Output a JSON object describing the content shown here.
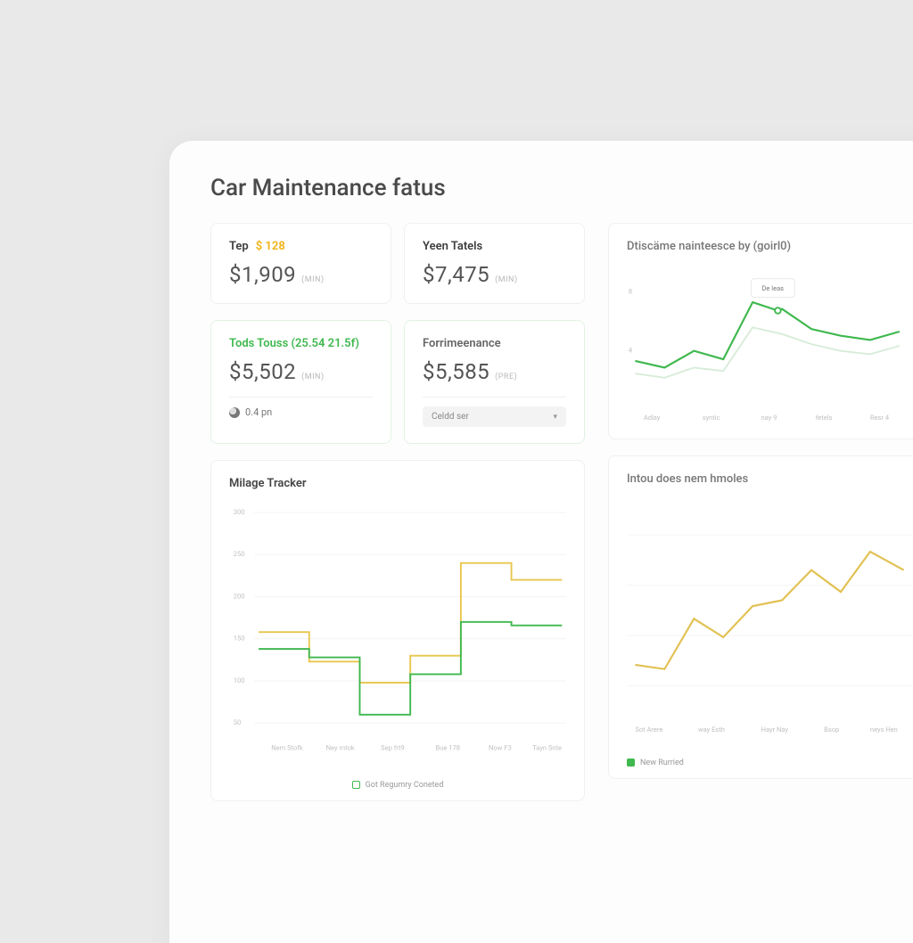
{
  "page": {
    "title": "Car Maintenance fatus"
  },
  "stats": {
    "top_left": {
      "label": "Tep",
      "tag": "$ 128",
      "value": "$1,909",
      "unit": "(min)"
    },
    "top_right": {
      "label": "Yeen Tatels",
      "value": "$7,475",
      "unit": "(min)"
    },
    "mid_left": {
      "label": "Tods Touss (25.54 21.5f)",
      "value": "$5,502",
      "unit": "(min)",
      "foot": "0.4 pn"
    },
    "mid_right": {
      "label": "Forrimeenance",
      "value": "$5,585",
      "unit": "(PRE)",
      "select": "Celdd ser"
    }
  },
  "charts": {
    "top_right": {
      "title": "Dtiscäme nainteesce by (goirl0)",
      "tooltip": "De leas"
    },
    "mileage": {
      "title": "Milage Tracker",
      "legend": "Got Regumry Coneted"
    },
    "bottom_right": {
      "title": "Intou does nem hmoles",
      "legend": "New Rurried"
    }
  },
  "chart_data": [
    {
      "id": "top_right",
      "type": "line",
      "title": "Dtiscäme nainteesce by (goirl0)",
      "x": [
        "Adlay",
        "syntic",
        "nay 9",
        "fetels",
        "Resr 4"
      ],
      "series": [
        {
          "name": "green",
          "color": "#3fb84e",
          "values": [
            40,
            35,
            48,
            38,
            78,
            72,
            62,
            58,
            55,
            60
          ]
        },
        {
          "name": "pale",
          "color": "#d7ecd9",
          "values": [
            30,
            28,
            35,
            32,
            60,
            55,
            50,
            45,
            42,
            48
          ]
        }
      ],
      "ylim": [
        0,
        100
      ]
    },
    {
      "id": "mileage",
      "type": "line",
      "title": "Milage Tracker",
      "x": [
        "Nem Stofk",
        "Ney mtok",
        "Sep frt9",
        "Bue 178",
        "Now F3",
        "Tayn Snte"
      ],
      "series": [
        {
          "name": "yellow",
          "color": "#e8c64c",
          "style": "step",
          "values": [
            160,
            160,
            120,
            120,
            95,
            95,
            130,
            130,
            240,
            240,
            220,
            220
          ]
        },
        {
          "name": "green",
          "color": "#3fb84e",
          "style": "step",
          "values": [
            140,
            140,
            130,
            130,
            55,
            55,
            105,
            105,
            170,
            170,
            165,
            165
          ]
        }
      ],
      "ylim": [
        0,
        300
      ],
      "legend": [
        "Got Regumry Coneted"
      ]
    },
    {
      "id": "bottom_right",
      "type": "line",
      "title": "Intou does nem hmoles",
      "x": [
        "Sot Arere",
        "way Esth",
        "Hayr Nay",
        "Bsop",
        "neys Hen"
      ],
      "series": [
        {
          "name": "yellow",
          "color": "#e2c152",
          "values": [
            95,
            90,
            140,
            120,
            150,
            155,
            185,
            160,
            200,
            180
          ]
        }
      ],
      "ylim": [
        0,
        250
      ],
      "legend": [
        "New Rurried"
      ]
    }
  ],
  "colors": {
    "green": "#3fb84e",
    "yellow": "#e8c64c",
    "pale_green": "#d7ecd9"
  }
}
